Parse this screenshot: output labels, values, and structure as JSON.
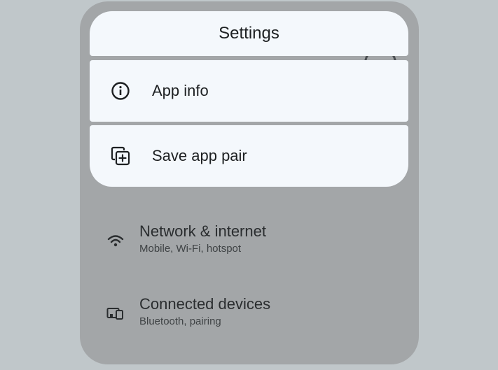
{
  "menu": {
    "title": "Settings",
    "items": [
      {
        "label": "App info",
        "icon": "info-icon"
      },
      {
        "label": "Save app pair",
        "icon": "save-app-pair-icon"
      }
    ]
  },
  "settings_list": [
    {
      "title": "Network & internet",
      "subtitle": "Mobile, Wi-Fi, hotspot",
      "icon": "wifi-icon"
    },
    {
      "title": "Connected devices",
      "subtitle": "Bluetooth, pairing",
      "icon": "connected-devices-icon"
    }
  ],
  "colors": {
    "background": "#c0c7ca",
    "window": "#a3a6a8",
    "menu_surface": "#f4f8fc",
    "text_primary": "#1d2022"
  }
}
